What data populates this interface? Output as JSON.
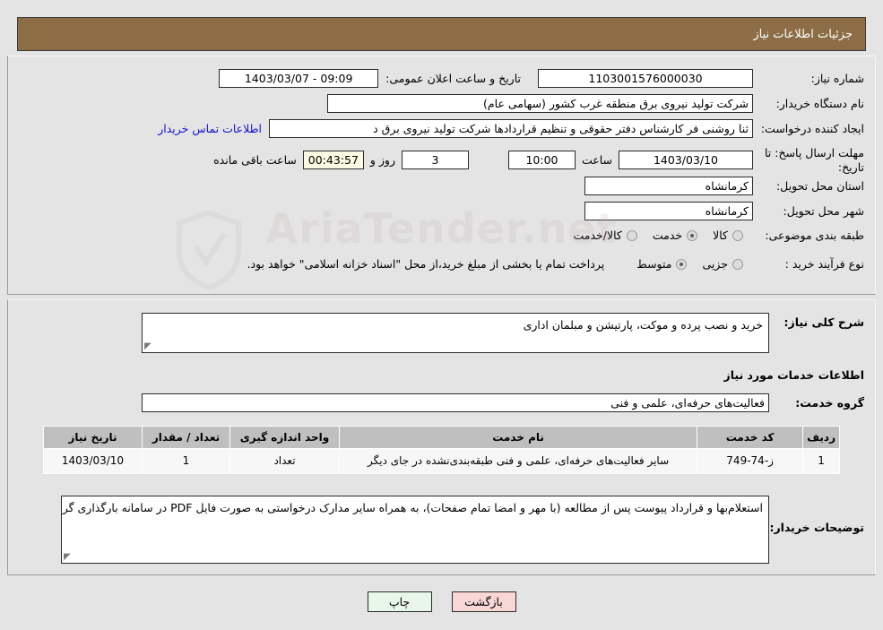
{
  "header": {
    "title": "جزئیات اطلاعات نیاز"
  },
  "form": {
    "need_number_label": "شماره نیاز:",
    "need_number_value": "1103001576000030",
    "public_announce_label": "تاریخ و ساعت اعلان عمومی:",
    "public_announce_value": "09:09 - 1403/03/07",
    "buyer_org_label": "نام دستگاه خریدار:",
    "buyer_org_value": "شرکت تولید نیروی برق منطقه غرب کشور (سهامی عام)",
    "requester_label": "ایجاد کننده درخواست:",
    "requester_value": "ثنا روشنی فر کارشناس دفتر حقوقی و تنظیم قراردادها شرکت تولید نیروی برق د",
    "buyer_contact_link": "اطلاعات تماس خریدار",
    "deadline_label": "مهلت ارسال پاسخ: تا تاریخ:",
    "deadline_date": "1403/03/10",
    "deadline_time_label": "ساعت",
    "deadline_time": "10:00",
    "remaining_days": "3",
    "remaining_days_label": "روز و",
    "remaining_clock": "00:43:57",
    "remaining_suffix": "ساعت باقی مانده",
    "province_label": "استان محل تحویل:",
    "province_value": "کرمانشاه",
    "city_label": "شهر محل تحویل:",
    "city_value": "کرمانشاه",
    "category_label": "طبقه بندی موضوعی:",
    "category_options": [
      {
        "label": "کالا",
        "selected": false
      },
      {
        "label": "خدمت",
        "selected": true
      },
      {
        "label": "کالا/خدمت",
        "selected": false
      }
    ],
    "process_label": "نوع فرآیند خرید :",
    "process_options": [
      {
        "label": "جزیی",
        "selected": false
      },
      {
        "label": "متوسط",
        "selected": true
      }
    ],
    "treasury_note": "پرداخت تمام یا بخشی از مبلغ خرید،از محل \"اسناد خزانه اسلامی\" خواهد بود."
  },
  "description": {
    "general_need_label": "شرح کلی نیاز:",
    "general_need_value": "خرید و نصب پرده و موکت، پارتیشن و مبلمان اداری",
    "services_heading": "اطلاعات خدمات مورد نیاز",
    "service_group_label": "گروه خدمت:",
    "service_group_value": "فعالیت‌های حرفه‌ای، علمی و فنی"
  },
  "table": {
    "headers": [
      "ردیف",
      "کد خدمت",
      "نام خدمت",
      "واحد اندازه گیری",
      "تعداد / مقدار",
      "تاریخ نیاز"
    ],
    "rows": [
      {
        "radif": "1",
        "code": "ز-74-749",
        "name": "سایر فعالیت‌های حرفه‌ای، علمی و فنی طبقه‌بندی‌نشده در جای دیگر",
        "unit": "تعداد",
        "qty": "1",
        "date": "1403/03/10"
      }
    ]
  },
  "buyer_notes": {
    "label": "توضیحات خریدار:",
    "value": "استعلام‌بها و قرارداد پیوست پس از مطالعه (با مهر و امضا تمام صفحات)، به همراه سایر مدارک درخواستی به صورت فایل PDF در سامانه بارگذاری گردد."
  },
  "buttons": {
    "print": "چاپ",
    "back": "بازگشت"
  },
  "watermark": {
    "text": "AriaTender.net"
  }
}
